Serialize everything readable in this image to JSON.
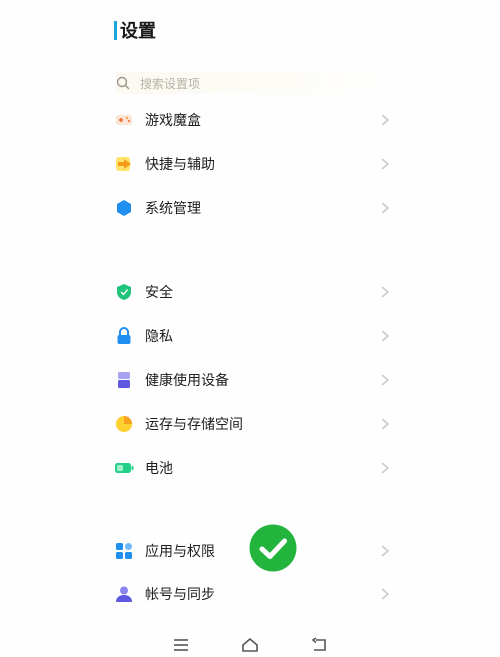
{
  "header": {
    "title": "设置",
    "accent_color": "#1aa7d8"
  },
  "search": {
    "placeholder": "搜索设置项",
    "icon": "search-icon"
  },
  "groups": [
    {
      "items": [
        {
          "label": "游戏魔盒",
          "icon": "game-box-icon"
        },
        {
          "label": "快捷与辅助",
          "icon": "shortcut-arrow-icon"
        },
        {
          "label": "系统管理",
          "icon": "hexagon-icon"
        }
      ]
    },
    {
      "items": [
        {
          "label": "安全",
          "icon": "shield-icon"
        },
        {
          "label": "隐私",
          "icon": "lock-icon"
        },
        {
          "label": "健康使用设备",
          "icon": "hourglass-icon"
        },
        {
          "label": "运存与存储空间",
          "icon": "pie-chart-icon"
        },
        {
          "label": "电池",
          "icon": "battery-icon"
        }
      ]
    },
    {
      "items": [
        {
          "label": "应用与权限",
          "icon": "apps-grid-icon"
        },
        {
          "label": "帐号与同步",
          "icon": "user-icon"
        }
      ]
    }
  ],
  "overlay": {
    "icon": "green-check-badge-icon",
    "color": "#22b43c"
  },
  "navbar": {
    "buttons": [
      "menu-icon",
      "home-icon",
      "back-icon"
    ]
  }
}
